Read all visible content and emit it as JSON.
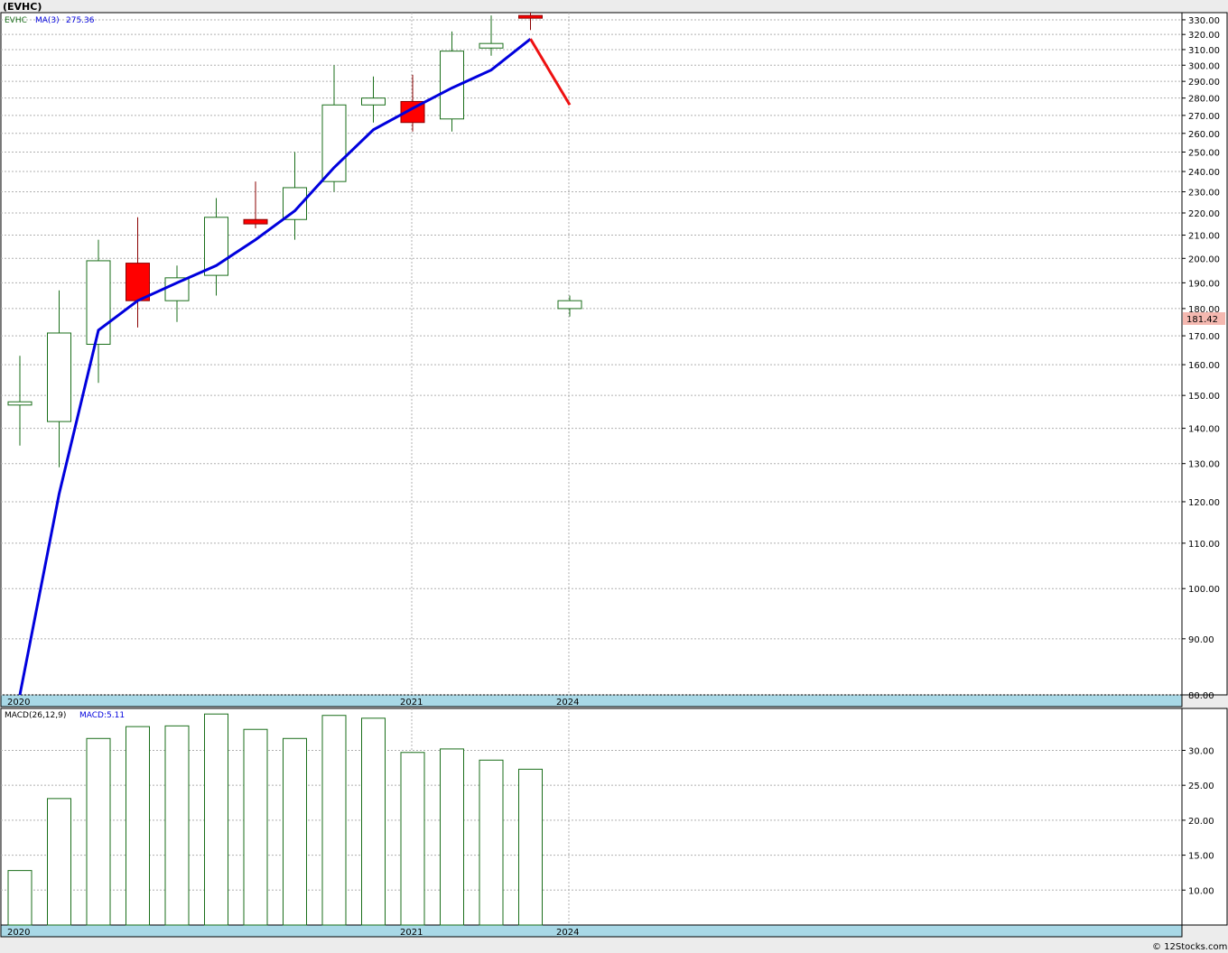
{
  "header": {
    "title": "(EVHC)"
  },
  "price_panel": {
    "ticker": "EVHC",
    "ma_label": "MA(3)",
    "ma_value": "275.36",
    "last_price": "181.42",
    "y_ticks": [
      "80.00",
      "90.00",
      "100.00",
      "110.00",
      "120.00",
      "130.00",
      "140.00",
      "150.00",
      "160.00",
      "170.00",
      "180.00",
      "190.00",
      "200.00",
      "210.00",
      "220.00",
      "230.00",
      "240.00",
      "250.00",
      "260.00",
      "270.00",
      "280.00",
      "290.00",
      "300.00",
      "310.00",
      "320.00",
      "330.00"
    ],
    "x_labels": [
      "2020",
      "2021",
      "2024"
    ]
  },
  "macd_panel": {
    "label": "MACD(26,12,9)",
    "macd_label": "MACD:5.11",
    "y_ticks": [
      "10.00",
      "15.00",
      "20.00",
      "25.00",
      "30.00"
    ],
    "x_labels": [
      "2020",
      "2021",
      "2024"
    ]
  },
  "footer": {
    "credit": "© 12Stocks.com"
  },
  "colors": {
    "up": "#1a6e1a",
    "down": "#ff0000",
    "ma": "#0000dd",
    "ma_tail": "#ee1111",
    "axis_band": "#a8d8e6",
    "grid": "#b0b0b0",
    "price_tag_bg": "#f4b8b0"
  },
  "chart_data": [
    {
      "type": "candlestick",
      "title": "(EVHC)",
      "y_scale": "log",
      "ylim": [
        80,
        335
      ],
      "candles": [
        {
          "open": 147,
          "high": 163,
          "low": 135,
          "close": 148
        },
        {
          "open": 142,
          "high": 187,
          "low": 129,
          "close": 171
        },
        {
          "open": 167,
          "high": 208,
          "low": 154,
          "close": 199
        },
        {
          "open": 198,
          "high": 218,
          "low": 173,
          "close": 183
        },
        {
          "open": 183,
          "high": 197,
          "low": 175,
          "close": 192
        },
        {
          "open": 193,
          "high": 227,
          "low": 185,
          "close": 218
        },
        {
          "open": 217,
          "high": 235,
          "low": 213,
          "close": 215
        },
        {
          "open": 217,
          "high": 250,
          "low": 208,
          "close": 232
        },
        {
          "open": 235,
          "high": 300,
          "low": 230,
          "close": 276
        },
        {
          "open": 276,
          "high": 293,
          "low": 266,
          "close": 280
        },
        {
          "open": 278,
          "high": 294,
          "low": 261,
          "close": 266
        },
        {
          "open": 268,
          "high": 322,
          "low": 261,
          "close": 309
        },
        {
          "open": 311,
          "high": 333,
          "low": 306,
          "close": 314
        },
        {
          "open": 333,
          "high": 335,
          "low": 323,
          "close": 332
        },
        {
          "open": 180,
          "high": 185,
          "low": 177,
          "close": 183
        }
      ],
      "ma_series": {
        "name": "MA(3)",
        "values": [
          80,
          122,
          172,
          183,
          190,
          197,
          208,
          221,
          242,
          262,
          274,
          286,
          297,
          317,
          276
        ]
      }
    },
    {
      "type": "bar",
      "title": "MACD(26,12,9)",
      "ylim": [
        5,
        36
      ],
      "values": [
        12.8,
        23.1,
        31.7,
        33.4,
        33.5,
        35.2,
        33.0,
        31.7,
        35.0,
        34.6,
        29.7,
        30.2,
        28.6,
        27.3
      ]
    }
  ]
}
